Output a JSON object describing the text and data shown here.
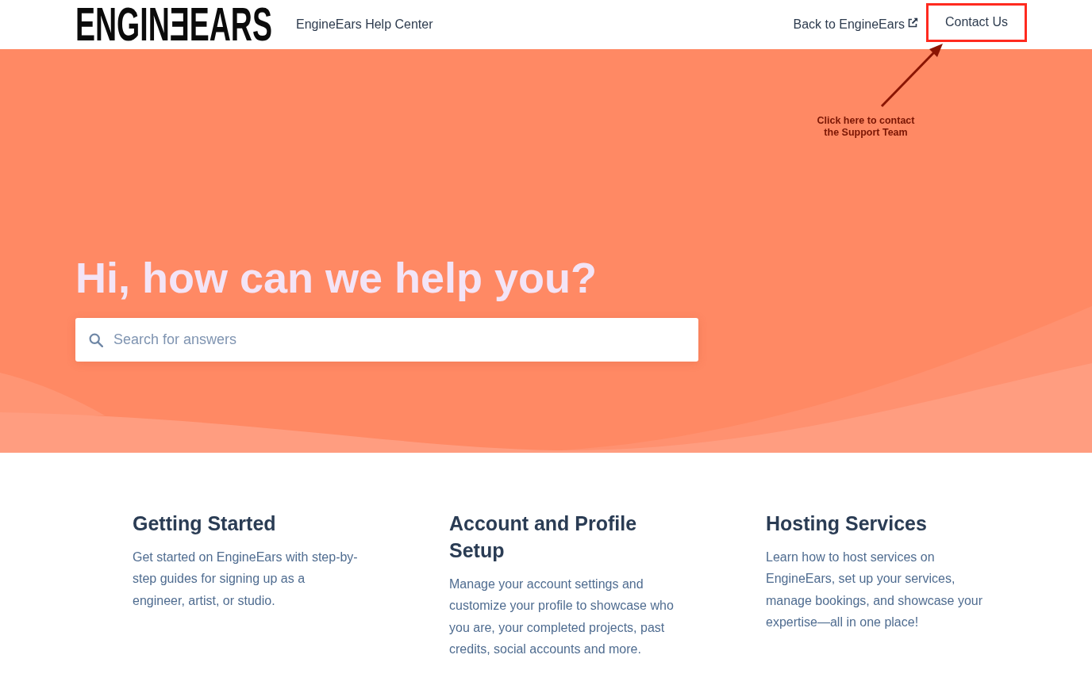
{
  "header": {
    "logo": "ENGINƎEARS",
    "site_title": "EngineEars Help Center",
    "links": [
      {
        "label": "Back to EngineEars",
        "external": true
      }
    ],
    "contact_button": {
      "label": "Contact Us",
      "highlighted": true
    }
  },
  "annotation": {
    "text": "Click here to contact\nthe Support Team"
  },
  "hero": {
    "heading": "Hi, how can we help you?",
    "search": {
      "placeholder": "Search for answers"
    }
  },
  "categories": [
    {
      "title": "Getting Started",
      "description": "Get started on EngineEars with step-by-step guides for signing up as a engineer, artist, or studio."
    },
    {
      "title": "Account and Profile Setup",
      "description": "Manage your account settings and customize your profile to showcase who you are, your completed projects, past credits, social accounts and more."
    },
    {
      "title": "Hosting Services",
      "description": "Learn how to host services on EngineEars, set up your services, manage bookings, and showcase your expertise—all in one place!"
    }
  ]
}
